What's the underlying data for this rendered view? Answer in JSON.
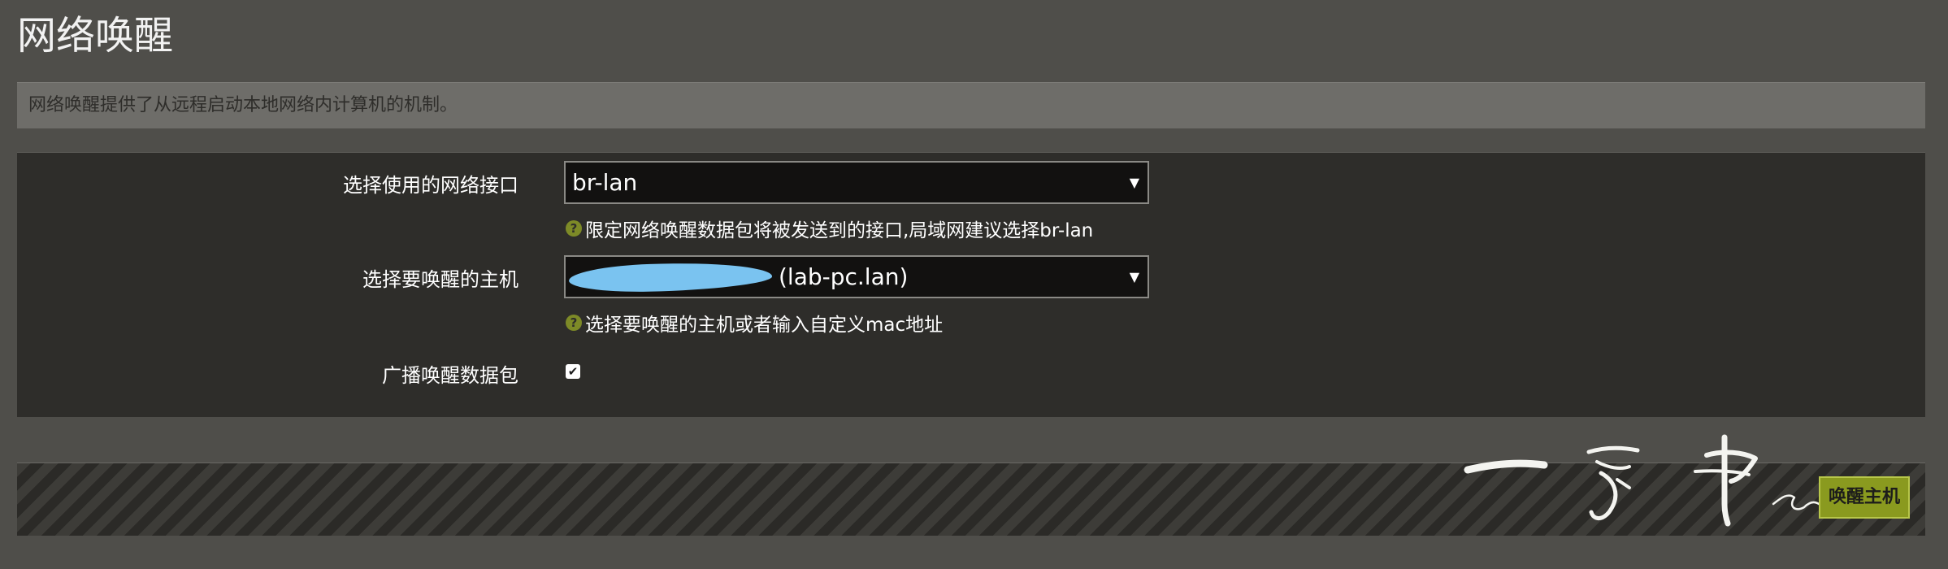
{
  "page": {
    "title": "网络唤醒",
    "description": "网络唤醒提供了从远程启动本地网络内计算机的机制。"
  },
  "form": {
    "interface": {
      "label": "选择使用的网络接口",
      "value": "br-lan",
      "help": "限定网络唤醒数据包将被发送到的接口,局域网建议选择br-lan"
    },
    "host": {
      "label": "选择要唤醒的主机",
      "value_visible": "(lab-pc.lan)",
      "help": "选择要唤醒的主机或者输入自定义mac地址"
    },
    "broadcast": {
      "label": "广播唤醒数据包",
      "checked": true
    }
  },
  "actions": {
    "wake_label": "唤醒主机"
  },
  "colors": {
    "background": "#4f4e4a",
    "panel": "#2e2d2a",
    "accent": "#8a9a1f",
    "redaction": "#7ac3f0"
  }
}
